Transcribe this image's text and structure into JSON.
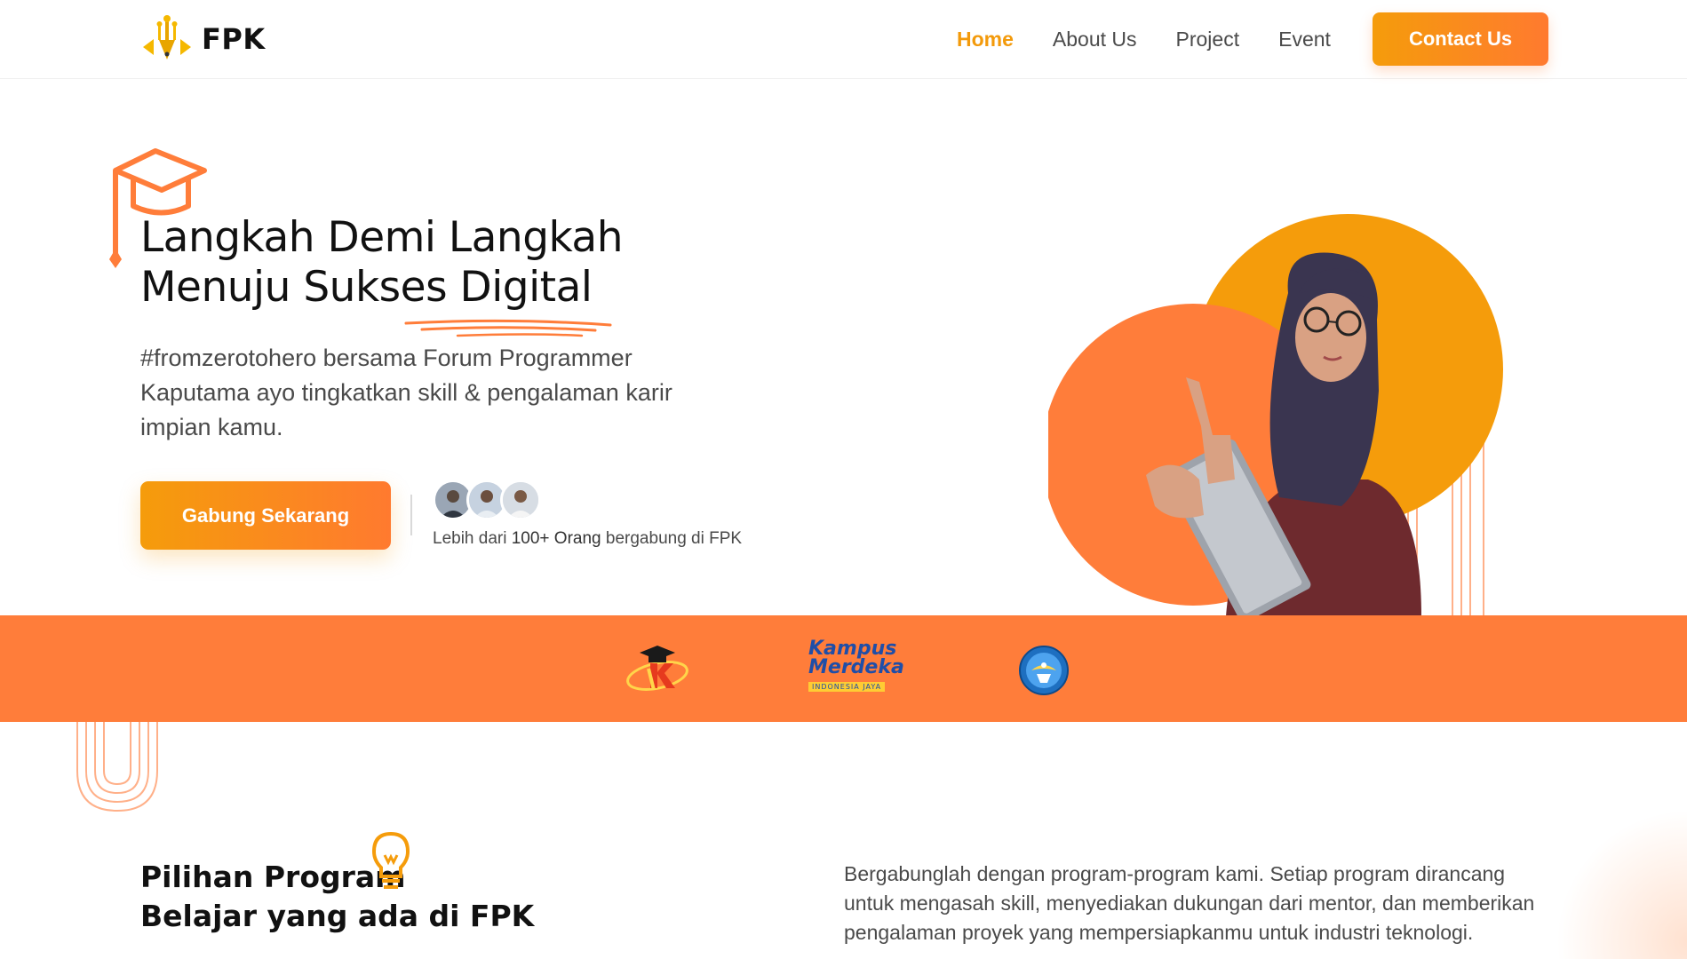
{
  "nav": {
    "brand": "FPK",
    "links": [
      {
        "label": "Home",
        "active": true
      },
      {
        "label": "About Us",
        "active": false
      },
      {
        "label": "Project",
        "active": false
      },
      {
        "label": "Event",
        "active": false
      }
    ],
    "cta": "Contact Us"
  },
  "hero": {
    "title_line1": "Langkah Demi Langkah",
    "title_line2": "Menuju Sukses Digital",
    "subtitle": "#fromzerotohero bersama Forum Programmer Kaputama ayo tingkatkan skill & pengalaman karir impian kamu.",
    "join_button": "Gabung Sekarang",
    "social_proof": {
      "prefix": "Lebih dari ",
      "highlight": "100+ Orang",
      "suffix": " bergabung di FPK"
    }
  },
  "partners": [
    {
      "name": "kaputama-logo"
    },
    {
      "name": "kampus-merdeka-logo",
      "text_line1": "Kampus",
      "text_line2": "Merdeka",
      "tagline": "INDONESIA JAYA"
    },
    {
      "name": "tut-wuri-handayani-logo"
    }
  ],
  "programs": {
    "title_line1": "Pilihan Program",
    "title_line2": "Belajar yang ada di FPK",
    "description": "Bergabunglah dengan program-program kami. Setiap program dirancang untuk mengasah skill, menyediakan dukungan dari mentor, dan memberikan pengalaman proyek yang mempersiapkanmu untuk industri teknologi."
  },
  "colors": {
    "primary": "#f59c0b",
    "accent": "#ff7d3a",
    "text_dark": "#111111",
    "text_muted": "#4a4a4a"
  }
}
